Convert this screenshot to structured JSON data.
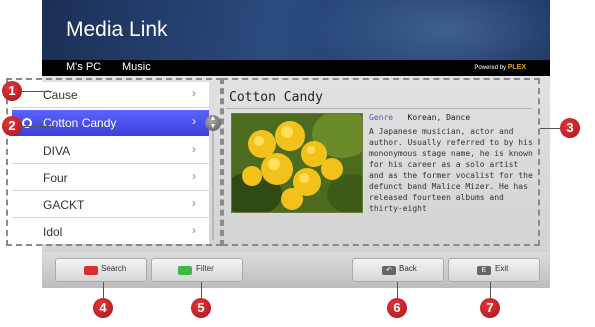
{
  "app": {
    "title": "Media Link"
  },
  "nav": {
    "tabs": [
      "M's PC",
      "Music"
    ],
    "powered_prefix": "Powered by",
    "powered_brand": "PLEX"
  },
  "list": {
    "items": [
      {
        "label": "Cause",
        "selected": false
      },
      {
        "label": "Cotton Candy",
        "selected": true
      },
      {
        "label": "DIVA",
        "selected": false
      },
      {
        "label": "Four",
        "selected": false
      },
      {
        "label": "GACKT",
        "selected": false
      },
      {
        "label": "Idol",
        "selected": false
      }
    ],
    "chevron": "›"
  },
  "detail": {
    "title": "Cotton Candy",
    "genre_label": "Genre",
    "genre_value": "Korean, Dance",
    "description": "A Japanese musician, actor and author. Usually referred to by his mononymous stage name, he is known for his career as a solo artist and as the former vocalist for the defunct band Malice Mizer. He has released fourteen albums and thirty-eight"
  },
  "footer": {
    "buttons": [
      {
        "label": "Search",
        "icon": "red-button-icon",
        "color": "#d83030"
      },
      {
        "label": "Filter",
        "icon": "green-button-icon",
        "color": "#3fb84a"
      },
      {
        "label": "Back",
        "icon": "back-icon",
        "color": "#666666"
      },
      {
        "label": "Exit",
        "icon": "exit-icon",
        "color": "#666666"
      }
    ]
  },
  "callouts": [
    "1",
    "2",
    "3",
    "4",
    "5",
    "6",
    "7"
  ],
  "colors": {
    "accent": "#4b52f0",
    "callout": "#c8202a",
    "header": "#223c6a"
  }
}
